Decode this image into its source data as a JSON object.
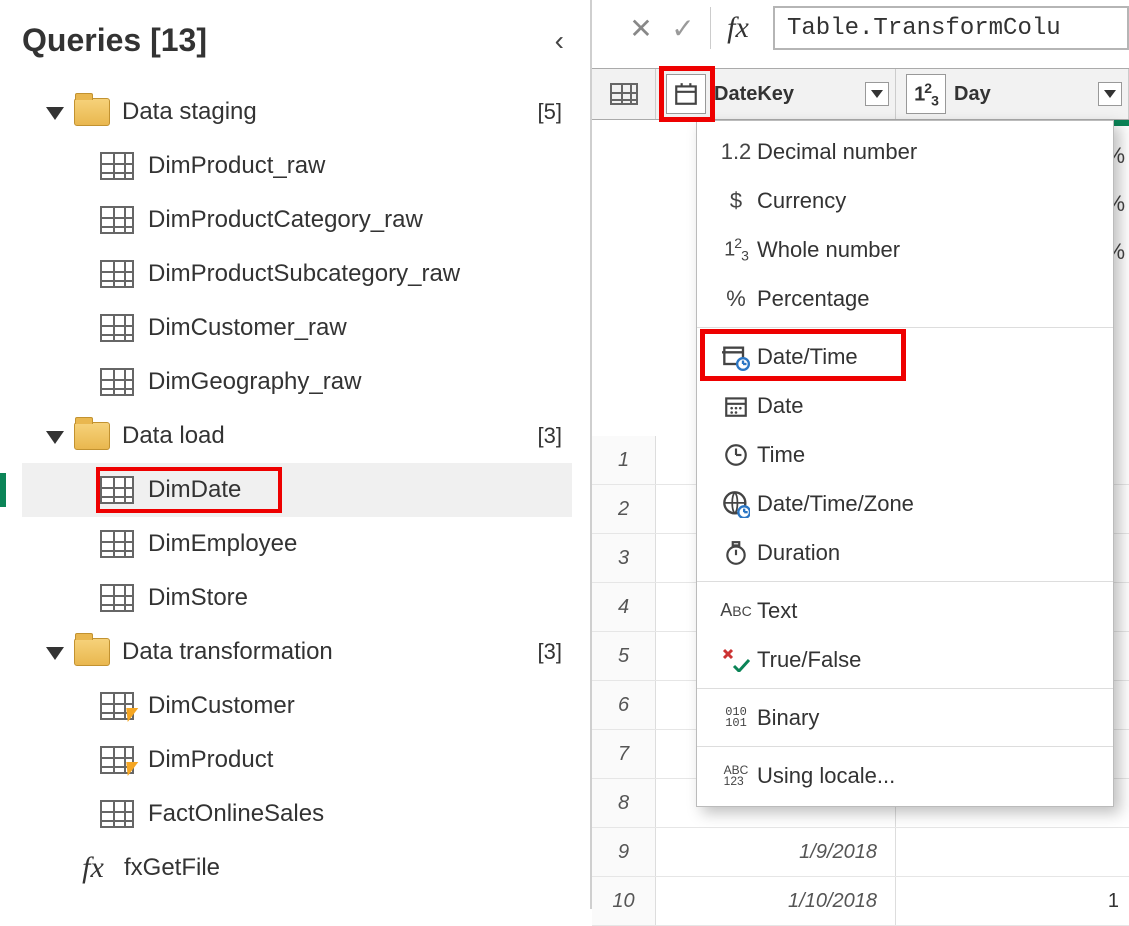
{
  "queries": {
    "title": "Queries [13]",
    "folders": [
      {
        "name": "Data staging",
        "count": "[5]",
        "items": [
          "DimProduct_raw",
          "DimProductCategory_raw",
          "DimProductSubcategory_raw",
          "DimCustomer_raw",
          "DimGeography_raw"
        ]
      },
      {
        "name": "Data load",
        "count": "[3]",
        "items": [
          "DimDate",
          "DimEmployee",
          "DimStore"
        ],
        "selected": "DimDate"
      },
      {
        "name": "Data transformation",
        "count": "[3]",
        "items": [
          "DimCustomer",
          "DimProduct",
          "FactOnlineSales"
        ],
        "bolt": [
          true,
          true,
          false
        ]
      }
    ],
    "fx_item": "fxGetFile"
  },
  "formula_bar": {
    "text": "Table.TransformColu"
  },
  "columns": {
    "col1": "DateKey",
    "col2": "Day"
  },
  "pct_labels": [
    "%",
    "%",
    "%"
  ],
  "rows": [
    {
      "idx": "1",
      "c1": "",
      "c2": ""
    },
    {
      "idx": "2",
      "c1": "",
      "c2": ""
    },
    {
      "idx": "3",
      "c1": "",
      "c2": ""
    },
    {
      "idx": "4",
      "c1": "",
      "c2": ""
    },
    {
      "idx": "5",
      "c1": "",
      "c2": ""
    },
    {
      "idx": "6",
      "c1": "",
      "c2": ""
    },
    {
      "idx": "7",
      "c1": "",
      "c2": ""
    },
    {
      "idx": "8",
      "c1": "",
      "c2": ""
    },
    {
      "idx": "9",
      "c1": "1/9/2018",
      "c2": ""
    },
    {
      "idx": "10",
      "c1": "1/10/2018",
      "c2": "1"
    }
  ],
  "type_menu": {
    "items": [
      {
        "label": "Decimal number",
        "icon": "1.2"
      },
      {
        "label": "Currency",
        "icon": "$"
      },
      {
        "label": "Whole number",
        "icon": "123"
      },
      {
        "label": "Percentage",
        "icon": "%"
      },
      {
        "sep": true
      },
      {
        "label": "Date/Time",
        "icon": "datetime",
        "highlight": true
      },
      {
        "label": "Date",
        "icon": "date"
      },
      {
        "label": "Time",
        "icon": "time"
      },
      {
        "label": "Date/Time/Zone",
        "icon": "zone"
      },
      {
        "label": "Duration",
        "icon": "duration"
      },
      {
        "sep": true
      },
      {
        "label": "Text",
        "icon": "abc"
      },
      {
        "label": "True/False",
        "icon": "bool"
      },
      {
        "sep": true
      },
      {
        "label": "Binary",
        "icon": "binary"
      },
      {
        "sep": true
      },
      {
        "label": "Using locale...",
        "icon": "abc123"
      }
    ]
  }
}
